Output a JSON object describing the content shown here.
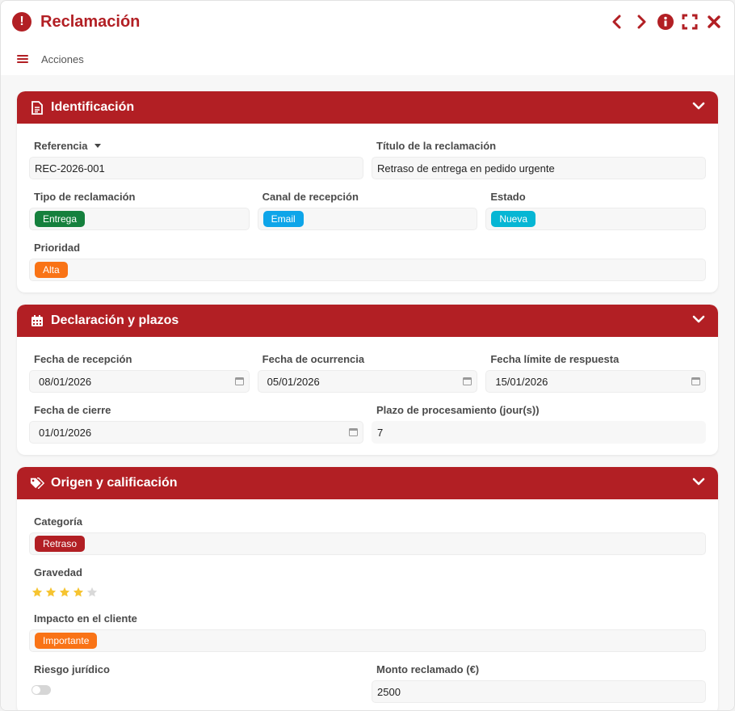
{
  "window": {
    "title": "Reclamación",
    "accent": "#b21f24"
  },
  "toolbar": {
    "actions_label": "Acciones"
  },
  "sections": {
    "identificacion": {
      "title": "Identificación",
      "referencia_label": "Referencia",
      "referencia_value": "REC-2026-001",
      "titulo_label": "Título de la reclamación",
      "titulo_value": "Retraso de entrega en pedido urgente",
      "tipo_label": "Tipo de reclamación",
      "tipo_value": "Entrega",
      "tipo_color": "#15803d",
      "canal_label": "Canal de recepción",
      "canal_value": "Email",
      "canal_color": "#0ea5e9",
      "estado_label": "Estado",
      "estado_value": "Nueva",
      "estado_color": "#06b6d4",
      "prioridad_label": "Prioridad",
      "prioridad_value": "Alta",
      "prioridad_color": "#f97316"
    },
    "declaracion": {
      "title": "Declaración y plazos",
      "fecha_recepcion_label": "Fecha de recepción",
      "fecha_recepcion_value": "08/01/2026",
      "fecha_ocurrencia_label": "Fecha de ocurrencia",
      "fecha_ocurrencia_value": "05/01/2026",
      "fecha_limite_label": "Fecha límite de respuesta",
      "fecha_limite_value": "15/01/2026",
      "fecha_cierre_label": "Fecha de cierre",
      "fecha_cierre_value": "01/01/2026",
      "plazo_label": "Plazo de procesamiento (jour(s))",
      "plazo_value": "7"
    },
    "origen": {
      "title": "Origen y calificación",
      "categoria_label": "Categoría",
      "categoria_value": "Retraso",
      "categoria_color": "#b21f24",
      "gravedad_label": "Gravedad",
      "gravedad_rating": 4,
      "gravedad_max": 5,
      "impacto_label": "Impacto en el cliente",
      "impacto_value": "Importante",
      "impacto_color": "#f97316",
      "riesgo_label": "Riesgo jurídico",
      "monto_label": "Monto reclamado (€)",
      "monto_value": "2500"
    }
  }
}
